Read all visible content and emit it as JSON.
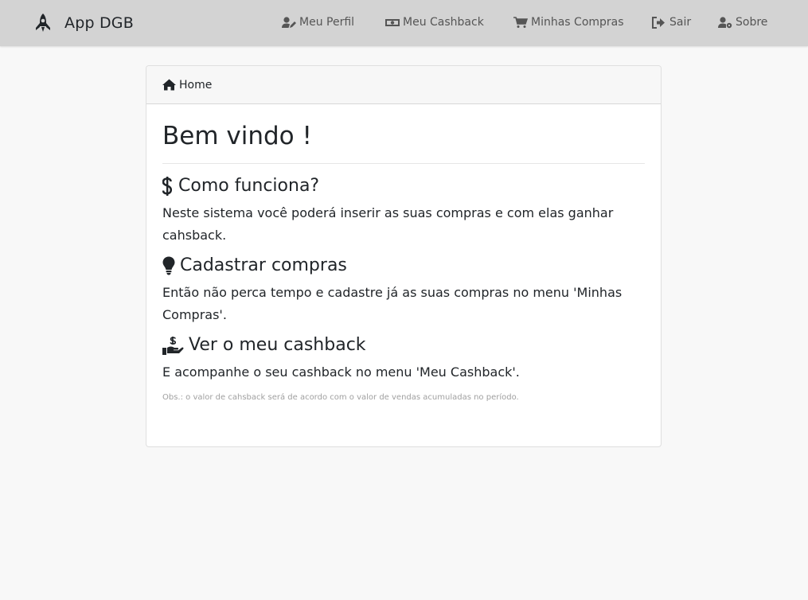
{
  "navbar": {
    "brand": "App DGB",
    "brand_icon": "rocket-icon",
    "links": [
      {
        "label": "Meu Perfil",
        "icon": "user-edit-icon"
      },
      {
        "label": "Meu Cashback",
        "icon": "money-bill-icon"
      },
      {
        "label": "Minhas Compras",
        "icon": "shopping-cart-icon"
      },
      {
        "label": "Sair",
        "icon": "sign-out-icon"
      },
      {
        "label": "Sobre",
        "icon": "user-cog-icon"
      }
    ]
  },
  "breadcrumb": {
    "label": "Home",
    "icon": "home-icon"
  },
  "main": {
    "title": "Bem vindo !",
    "sections": [
      {
        "title": "Como funciona?",
        "icon": "dollar-icon",
        "text": "Neste sistema você poderá inserir as suas compras e com elas ganhar cahsback."
      },
      {
        "title": "Cadastrar compras",
        "icon": "lightbulb-icon",
        "text": "Então não perca tempo e cadastre já as suas compras no menu 'Minhas Compras'."
      },
      {
        "title": "Ver o meu cashback",
        "icon": "hand-holding-usd-icon",
        "text": "E acompanhe o seu cashback no menu 'Meu Cashback'."
      }
    ],
    "note": "Obs.: o valor de cahsback será de acordo com o valor de vendas acumuladas no período."
  },
  "colors": {
    "navbar_bg": "#d3d3d3",
    "page_bg": "#f8f8f8",
    "text": "#212529",
    "nav_text": "#555555"
  }
}
